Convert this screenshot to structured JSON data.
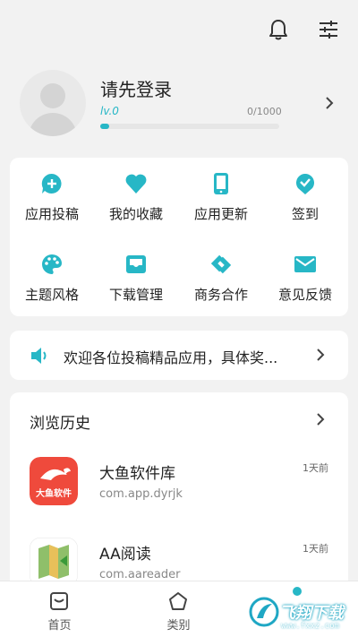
{
  "colors": {
    "accent": "#27b7c6",
    "background": "#f2f2f2",
    "card": "#ffffff"
  },
  "topbar": {
    "icons": [
      "bell-icon",
      "sliders-icon"
    ]
  },
  "profile": {
    "title": "请先登录",
    "level": "lv.0",
    "exp": "0/1000",
    "exp_fraction": 0.05
  },
  "grid": {
    "items": [
      {
        "label": "应用投稿",
        "icon": "chat-plus-icon"
      },
      {
        "label": "我的收藏",
        "icon": "heart-icon"
      },
      {
        "label": "应用更新",
        "icon": "phone-icon"
      },
      {
        "label": "签到",
        "icon": "check-badge-icon"
      },
      {
        "label": "主题风格",
        "icon": "palette-icon"
      },
      {
        "label": "下载管理",
        "icon": "inbox-icon"
      },
      {
        "label": "商务合作",
        "icon": "handshake-icon"
      },
      {
        "label": "意见反馈",
        "icon": "mail-icon"
      }
    ]
  },
  "notice": {
    "text": "欢迎各位投稿精品应用，具体奖..."
  },
  "history": {
    "title": "浏览历史",
    "apps": [
      {
        "name": "大鱼软件库",
        "package": "com.app.dyrjk",
        "time": "1天前",
        "icon_text": "大鱼软件"
      },
      {
        "name": "AA阅读",
        "package": "com.aareader",
        "time": "1天前"
      }
    ]
  },
  "bottom_nav": {
    "items": [
      {
        "label": "首页",
        "icon": "home-icon"
      },
      {
        "label": "类别",
        "icon": "pentagon-icon"
      }
    ]
  },
  "watermark": {
    "text": "飞翔下载",
    "sub": "www.fxxz.com"
  }
}
